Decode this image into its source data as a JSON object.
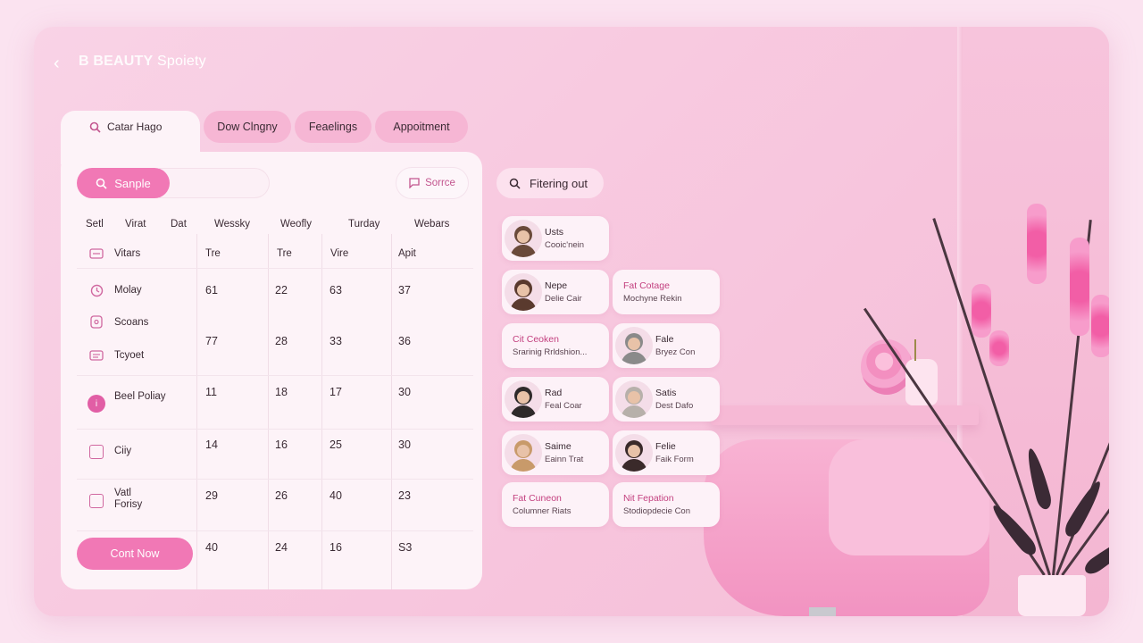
{
  "brand": {
    "bold": "B BEAUTY",
    "rest": " Spoiety"
  },
  "search_tab": {
    "value": "Catar Hago"
  },
  "tabs": [
    {
      "label": "Dow Clngny"
    },
    {
      "label": "Feaelings"
    },
    {
      "label": "Appoitment"
    }
  ],
  "toolbar": {
    "sample_label": "Sanple",
    "source_label": "Sorrce"
  },
  "grid": {
    "columns": [
      "Setl",
      "Virat",
      "Dat",
      "Wessky",
      "Weofly",
      "Turday",
      "Webars"
    ],
    "subheaders": [
      "Tre",
      "Tre",
      "Vire",
      "Apit"
    ],
    "rows": [
      {
        "label": "Vitars",
        "icon": "card-icon",
        "values": []
      },
      {
        "label": "Molay",
        "icon": "clock-icon",
        "values": [
          "61",
          "22",
          "63",
          "37"
        ]
      },
      {
        "label": "Scoans",
        "icon": "gift-icon",
        "values": []
      },
      {
        "label": "Tcyoet",
        "icon": "list-icon",
        "values": [
          "77",
          "28",
          "33",
          "36"
        ]
      },
      {
        "label": "Beel Poliay",
        "icon": "info-icon",
        "values": [
          "11",
          "18",
          "17",
          "30"
        ]
      },
      {
        "label": "Ciiy",
        "icon": "checkbox-icon",
        "values": [
          "14",
          "16",
          "25",
          "30"
        ]
      },
      {
        "label": "Vatl Forisy",
        "icon": "checkbox-icon",
        "values": [
          "29",
          "26",
          "40",
          "23"
        ]
      },
      {
        "label": "",
        "icon": "",
        "values": [
          "40",
          "24",
          "16",
          "S3"
        ]
      }
    ]
  },
  "cta_label": "Cont Now",
  "filter_label": "Fitering out",
  "cards": [
    {
      "name": "Usts",
      "sub": "Cooic'nein",
      "type": "avatar",
      "tone": "#6a4a3a"
    },
    {
      "name": "Nepe",
      "sub": "Delie Cair",
      "type": "avatar",
      "tone": "#5a3a2e"
    },
    {
      "name": "Fat Cotage",
      "sub": "Mochyne Rekin",
      "type": "text"
    },
    {
      "name": "Cit Ceoken",
      "sub": "Srarinig Rrldshion...",
      "type": "text"
    },
    {
      "name": "Fale",
      "sub": "Bryez Con",
      "type": "avatar",
      "tone": "#8a8a8a"
    },
    {
      "name": "Rad",
      "sub": "Feal Coar",
      "type": "avatar",
      "tone": "#2e2a2a"
    },
    {
      "name": "Satis",
      "sub": "Dest Dafo",
      "type": "avatar",
      "tone": "#b7b0aa"
    },
    {
      "name": "Saime",
      "sub": "Eainn Trat",
      "type": "avatar",
      "tone": "#c89a6a"
    },
    {
      "name": "Felie",
      "sub": "Faik Form",
      "type": "avatar",
      "tone": "#3a2a2a"
    },
    {
      "name": "Fat Cuneon",
      "sub": "Columner Riats",
      "type": "text"
    },
    {
      "name": "Nit Fepation",
      "sub": "Stodiopdecie Con",
      "type": "text"
    }
  ],
  "colors": {
    "accent": "#f178b5",
    "accent_dark": "#c3407f",
    "panel": "#fdf3f8",
    "background": "#f7c5dd"
  }
}
